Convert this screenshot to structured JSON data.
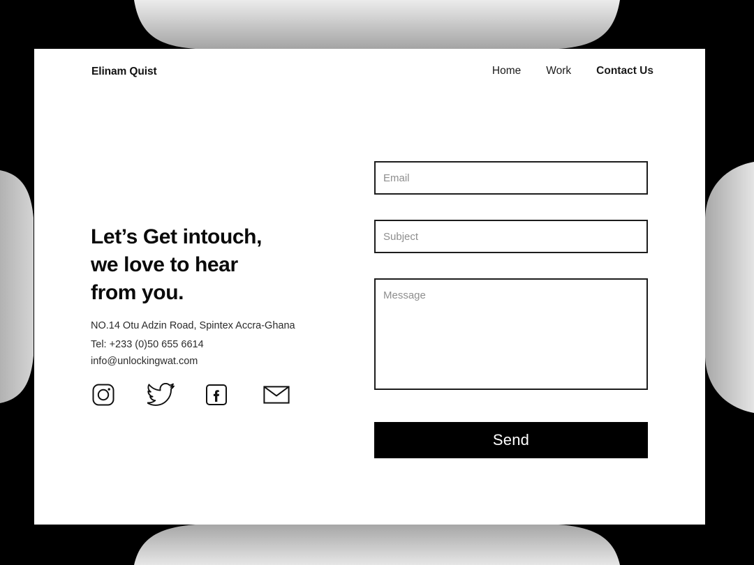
{
  "header": {
    "brand": "Elinam Quist",
    "nav": [
      {
        "label": "Home",
        "active": false
      },
      {
        "label": "Work",
        "active": false
      },
      {
        "label": "Contact Us",
        "active": true
      }
    ]
  },
  "hero": {
    "headline": "Let’s Get intouch,\nwe love to hear\nfrom  you.",
    "address": "NO.14 Otu Adzin Road, Spintex Accra-Ghana",
    "phone": "Tel: +233 (0)50 655 6614",
    "email": "info@unlockingwat.com"
  },
  "socials": [
    {
      "name": "instagram",
      "label": "Instagram"
    },
    {
      "name": "twitter",
      "label": "Twitter"
    },
    {
      "name": "facebook",
      "label": "Facebook"
    },
    {
      "name": "email",
      "label": "Email"
    }
  ],
  "form": {
    "email_placeholder": "Email",
    "email_value": "",
    "subject_placeholder": "Subject",
    "subject_value": "",
    "message_placeholder": "Message",
    "message_value": "",
    "send_label": "Send"
  },
  "theme": {
    "page_background": "#000000",
    "card_background": "#ffffff",
    "accent": "#000000",
    "text": "#111111",
    "placeholder": "#8e8e8e",
    "backdrop_gradient_light": "#ebebeb",
    "backdrop_gradient_dark": "#a4a4a4"
  }
}
